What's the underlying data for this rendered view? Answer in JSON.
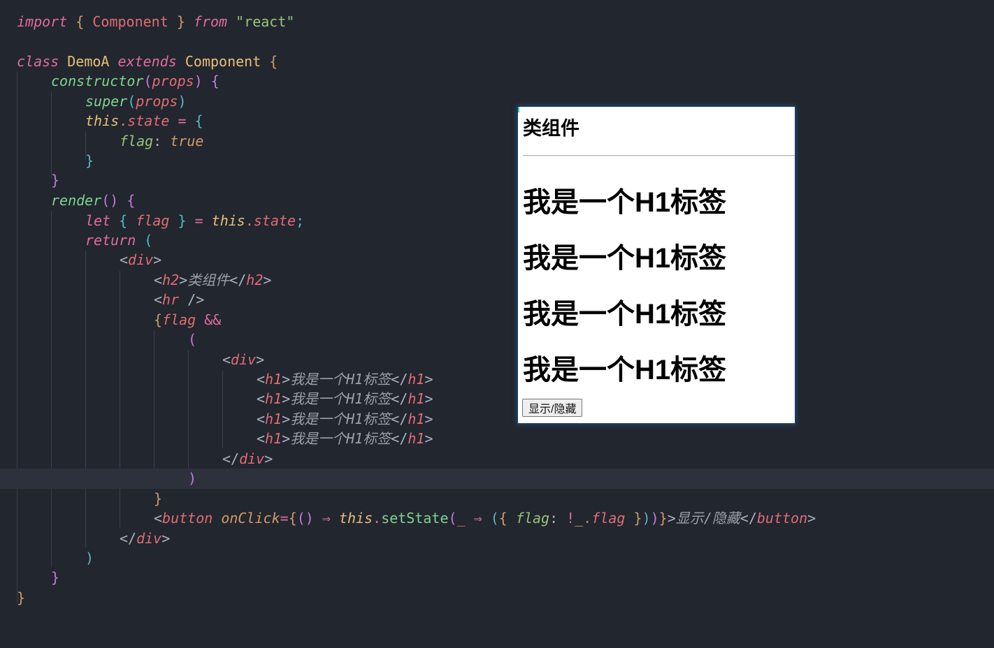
{
  "editor": {
    "theme_colors": {
      "background": "#22262e",
      "current_line": "#2c313c",
      "keyword": "#e06c9f",
      "class_name": "#e5c07b",
      "string": "#98c379",
      "function": "#7ed491",
      "tag": "#e06c75"
    },
    "lines": {
      "l1": {
        "import": "import",
        "ob": "{",
        "name": "Component",
        "cb": "}",
        "from": "from",
        "module": "\"react\""
      },
      "l3": {
        "class": "class",
        "name": "DemoA",
        "extends": "extends",
        "base": "Component",
        "ob": "{"
      },
      "l4": {
        "fn": "constructor",
        "op": "(",
        "param": "props",
        "cp": ")",
        "ob": "{"
      },
      "l5": {
        "fn": "super",
        "op": "(",
        "param": "props",
        "cp": ")"
      },
      "l6": {
        "this": "this",
        "dot": ".",
        "prop": "state",
        "eq": "=",
        "ob": "{"
      },
      "l7": {
        "key": "flag",
        "colon": ":",
        "val": "true"
      },
      "l8": {
        "cb": "}"
      },
      "l9": {
        "cb": "}"
      },
      "l10": {
        "fn": "render",
        "parens": "()",
        "ob": "{"
      },
      "l11": {
        "let": "let",
        "ob": "{",
        "var": "flag",
        "cb": "}",
        "eq": "=",
        "this": "this",
        "dot": ".",
        "prop": "state",
        "semi": ";"
      },
      "l12": {
        "ret": "return",
        "op": "("
      },
      "l13": {
        "lt": "<",
        "tag": "div",
        "gt": ">"
      },
      "l14": {
        "lt": "<",
        "tag": "h2",
        "gt": ">",
        "text": "类组件",
        "lt2": "</",
        "tag2": "h2",
        "gt2": ">"
      },
      "l15": {
        "lt": "<",
        "tag": "hr",
        "end": " />"
      },
      "l16": {
        "ob": "{",
        "var": "flag",
        "and": "&&"
      },
      "l17": {
        "op": "("
      },
      "l18": {
        "lt": "<",
        "tag": "div",
        "gt": ">"
      },
      "h1_line": {
        "lt": "<",
        "tag": "h1",
        "gt": ">",
        "text": "我是一个H1标签",
        "lt2": "</",
        "tag2": "h1",
        "gt2": ">"
      },
      "l23": {
        "lt": "</",
        "tag": "div",
        "gt": ">"
      },
      "l24": {
        "cp": ")"
      },
      "l25": {
        "cb": "}"
      },
      "l26": {
        "lt": "<",
        "tag": "button",
        "attr": "onClick",
        "eq": "=",
        "ob": "{",
        "parens": "()",
        "arrow": "⇒",
        "this": "this",
        "dot": ".",
        "call": "setState",
        "op": "(",
        "arg": "_",
        "arrow2": "⇒",
        "op2": "(",
        "ob2": "{",
        "key": "flag",
        "colon": ":",
        "not": "!",
        "arg2": "_",
        "dot2": ".",
        "prop": "flag",
        "cb2": "}",
        "cp2": ")",
        "cp": ")",
        "cb": "}",
        "gt": ">",
        "text": "显示/隐藏",
        "lt2": "</",
        "tag2": "button",
        "gt2": ">"
      },
      "l27": {
        "lt": "</",
        "tag": "div",
        "gt": ">"
      },
      "l28": {
        "cp": ")"
      },
      "l29": {
        "cb": "}"
      },
      "l30": {
        "cb": "}"
      }
    }
  },
  "preview": {
    "heading": "类组件",
    "h1_items": [
      "我是一个H1标签",
      "我是一个H1标签",
      "我是一个H1标签",
      "我是一个H1标签"
    ],
    "toggle_button_label": "显示/隐藏"
  }
}
